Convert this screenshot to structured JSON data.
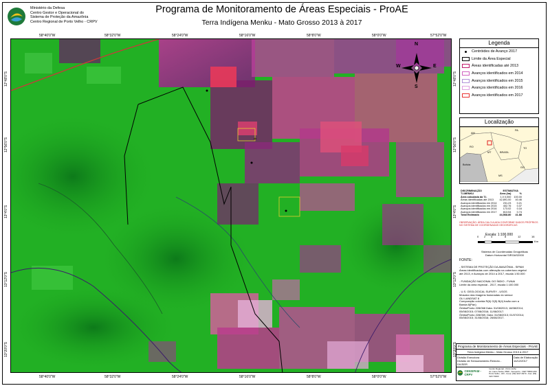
{
  "header": {
    "org_lines": [
      "Ministério da Defesa",
      "Centro Gestor e Operacional do",
      "Sistema de Proteção da Amazônia",
      "Centro Regional de Porto Velho - CRPV"
    ],
    "title": "Programa de Monitoramento de Áreas Especiais - ProAE",
    "subtitle": "Terra Indígena Menku - Mato Grosso 2013 à 2017"
  },
  "map": {
    "top_coords": [
      "58°40'0\"W",
      "58°32'0\"W",
      "58°24'0\"W",
      "58°16'0\"W",
      "58°8'0\"W",
      "58°0'0\"W",
      "57°52'0\"W"
    ],
    "bottom_coords": [
      "58°40'0\"W",
      "58°32'0\"W",
      "58°24'0\"W",
      "58°16'0\"W",
      "58°8'0\"W",
      "58°0'0\"W",
      "57°52'0\"W"
    ],
    "left_coords": [
      "12°48'0\"S",
      "12°56'0\"S",
      "13°4'0\"S",
      "13°12'0\"S",
      "13°20'0\"S"
    ],
    "right_coords": [
      "12°48'0\"S",
      "12°56'0\"S",
      "13°4'0\"S",
      "13°12'0\"S",
      "13°20'0\"S"
    ],
    "north_arrow": {
      "n": "N",
      "s": "S",
      "e": "E",
      "w": "W"
    }
  },
  "legend": {
    "title": "Legenda",
    "items": [
      {
        "label": "Centróides de Avanço 2017",
        "color": "#000000",
        "kind": "dot"
      },
      {
        "label": "Limite da Área Especial",
        "color": "#000000",
        "kind": "box"
      },
      {
        "label": "Áreas identificadas  até 2013",
        "color": "#c0186a",
        "kind": "box"
      },
      {
        "label": "Avanços identificados em 2014",
        "color": "#d060c0",
        "kind": "box"
      },
      {
        "label": "Avanços identificados em 2015",
        "color": "#b090d8",
        "kind": "box"
      },
      {
        "label": "Avanços identificados em 2016",
        "color": "#e0a0e0",
        "kind": "box"
      },
      {
        "label": "Avanços identificados em 2017",
        "color": "#e83030",
        "kind": "box"
      }
    ]
  },
  "locator": {
    "title": "Localização",
    "states": [
      "AM",
      "PA",
      "RO",
      "MT",
      "BRASIL",
      "TO",
      "Bolívia",
      "GO",
      "MS"
    ]
  },
  "stats": {
    "header": [
      "DISCRIMINAÇÃO",
      "ESTIMATIVA"
    ],
    "subheader": [
      "T.I.MENKU",
      "Área (ha)",
      "%"
    ],
    "rows": [
      [
        "Área calculada da T.I.",
        "1.0 0,000",
        "100.00"
      ],
      [
        "Áreas identificadas até 2013",
        "42,891.00",
        "40.46"
      ],
      [
        "Avanços identificados em 2014",
        "231.23",
        "0.21"
      ],
      [
        "Avanços identificados em 2015",
        "402.76",
        "0.37"
      ],
      [
        "Avanços identificados em 2016",
        "173.02",
        "0.16"
      ],
      [
        "Avanços identificados em 2017",
        "813.54",
        "0.74"
      ],
      [
        "Total Estimado",
        "44,568.80",
        "41.88"
      ]
    ],
    "note": "OBSERVAÇÃO: ÁREA CALCULADA CONFORME DADOS PRÓPRIOS NO SISTEMA DE COORDENADAS GEOGRÁFICAS"
  },
  "scale": {
    "label": "Escala:  1:100.000",
    "ticks": [
      "0",
      "2",
      "4",
      "8",
      "12",
      "16"
    ],
    "unit": "Km",
    "datum_lines": [
      "Sistema de Coordenadas Geográficas",
      "Datum Horizontal SIRGAS2000"
    ]
  },
  "sources": {
    "heading": "FONTE:",
    "blocks": [
      [
        "- SISTEMA DE PROTEÇÃO DA AMAZÔNIA - SIPAM",
        "  Áreas identificadas com alteração na cobertura vegetal",
        "  até 2013, e Avanços de 2014 a 2017, escala 1:50.000"
      ],
      [
        "- FUNDAÇÃO NACIONAL DO ÍNDIO - FUNAI",
        "  Limite da área especial - 2017, escala 1:100.000"
      ],
      [
        "- U.S. GEOLOGICAL SURVEY - USGS",
        "  Mosaico das imagens fusionadas do sensor",
        "  OLI LANDSAT 8",
        "  Composição colorida R(6) G(5) B(4) fusão com a",
        "  Banda 8(Pan)",
        "  Órbita/Ponto 228/068 Data: 31/08/2013; 18/08/2014;",
        "  05/08/2015; 07/08/2016; 11/08/2017.",
        "  Órbita/Ponto 228/069, Data: 31/08/2013; 01/07/2014;",
        "  05/08/2015; 31/08/2016; 26/08/2017."
      ]
    ]
  },
  "footer": {
    "title": "Programa de Monitoramento de Áreas Especiais - ProAE",
    "subtitle": "Terra Indígena Menku - Mato Grosso 2013 à 2017",
    "col_left_label": "Divisão Executora",
    "col_left_value": "Divisão de Sensoriamento Remoto - DIVSER",
    "col_right_label": "Data de Elaboração",
    "col_right_value": "14/12/2017",
    "brand": "CENSIPAM - CRPV",
    "address_lines": [
      "Centro Regional - Porto Velho",
      "Av. Lauro Sodré, 6500 - Aeroporto - CEP 76803-260",
      "Porto Velho - RO - Fone: (69) 3217-6373 - Fax: (69) 3217-6303"
    ]
  }
}
